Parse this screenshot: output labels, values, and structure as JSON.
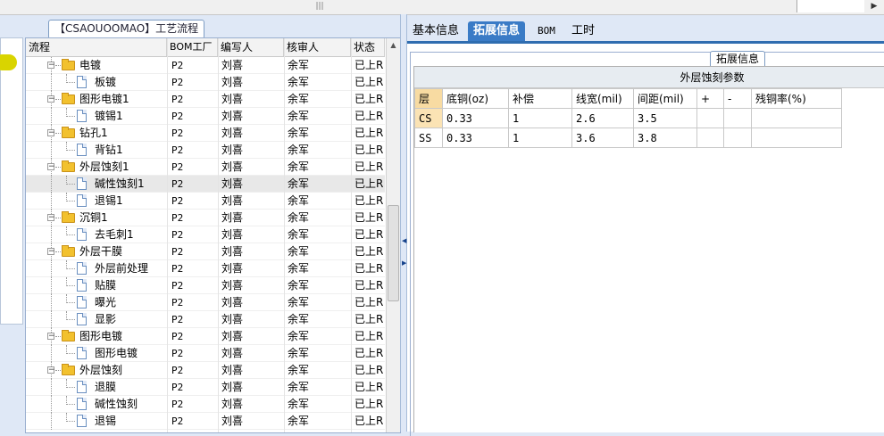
{
  "left_tab_title": "【CSAOUOOMAO】工艺流程",
  "left_grid": {
    "columns": [
      "流程",
      "BOM工厂",
      "编写人",
      "核审人",
      "状态"
    ],
    "rows": [
      {
        "name": "电镀",
        "level": 1,
        "type": "folder",
        "bom": "P2",
        "writer": "刘喜",
        "reviewer": "余军",
        "status": "已上R"
      },
      {
        "name": "板镀",
        "level": 2,
        "type": "doc",
        "bom": "P2",
        "writer": "刘喜",
        "reviewer": "余军",
        "status": "已上R"
      },
      {
        "name": "图形电镀1",
        "level": 1,
        "type": "folder",
        "bom": "P2",
        "writer": "刘喜",
        "reviewer": "余军",
        "status": "已上R"
      },
      {
        "name": "镀锡1",
        "level": 2,
        "type": "doc",
        "bom": "P2",
        "writer": "刘喜",
        "reviewer": "余军",
        "status": "已上R"
      },
      {
        "name": "钻孔1",
        "level": 1,
        "type": "folder",
        "bom": "P2",
        "writer": "刘喜",
        "reviewer": "余军",
        "status": "已上R"
      },
      {
        "name": "背钻1",
        "level": 2,
        "type": "doc",
        "bom": "P2",
        "writer": "刘喜",
        "reviewer": "余军",
        "status": "已上R"
      },
      {
        "name": "外层蚀刻1",
        "level": 1,
        "type": "folder",
        "bom": "P2",
        "writer": "刘喜",
        "reviewer": "余军",
        "status": "已上R"
      },
      {
        "name": "碱性蚀刻1",
        "level": 2,
        "type": "doc",
        "bom": "P2",
        "writer": "刘喜",
        "reviewer": "余军",
        "status": "已上R",
        "selected": true
      },
      {
        "name": "退锡1",
        "level": 2,
        "type": "doc",
        "bom": "P2",
        "writer": "刘喜",
        "reviewer": "余军",
        "status": "已上R"
      },
      {
        "name": "沉铜1",
        "level": 1,
        "type": "folder",
        "bom": "P2",
        "writer": "刘喜",
        "reviewer": "余军",
        "status": "已上R"
      },
      {
        "name": "去毛刺1",
        "level": 2,
        "type": "doc",
        "bom": "P2",
        "writer": "刘喜",
        "reviewer": "余军",
        "status": "已上R"
      },
      {
        "name": "外层干膜",
        "level": 1,
        "type": "folder",
        "bom": "P2",
        "writer": "刘喜",
        "reviewer": "余军",
        "status": "已上R"
      },
      {
        "name": "外层前处理",
        "level": 2,
        "type": "doc",
        "bom": "P2",
        "writer": "刘喜",
        "reviewer": "余军",
        "status": "已上R"
      },
      {
        "name": "贴膜",
        "level": 2,
        "type": "doc",
        "bom": "P2",
        "writer": "刘喜",
        "reviewer": "余军",
        "status": "已上R"
      },
      {
        "name": "曝光",
        "level": 2,
        "type": "doc",
        "bom": "P2",
        "writer": "刘喜",
        "reviewer": "余军",
        "status": "已上R"
      },
      {
        "name": "显影",
        "level": 2,
        "type": "doc",
        "bom": "P2",
        "writer": "刘喜",
        "reviewer": "余军",
        "status": "已上R"
      },
      {
        "name": "图形电镀",
        "level": 1,
        "type": "folder",
        "bom": "P2",
        "writer": "刘喜",
        "reviewer": "余军",
        "status": "已上R"
      },
      {
        "name": "图形电镀",
        "level": 2,
        "type": "doc",
        "bom": "P2",
        "writer": "刘喜",
        "reviewer": "余军",
        "status": "已上R"
      },
      {
        "name": "外层蚀刻",
        "level": 1,
        "type": "folder",
        "bom": "P2",
        "writer": "刘喜",
        "reviewer": "余军",
        "status": "已上R"
      },
      {
        "name": "退膜",
        "level": 2,
        "type": "doc",
        "bom": "P2",
        "writer": "刘喜",
        "reviewer": "余军",
        "status": "已上R"
      },
      {
        "name": "碱性蚀刻",
        "level": 2,
        "type": "doc",
        "bom": "P2",
        "writer": "刘喜",
        "reviewer": "余军",
        "status": "已上R"
      },
      {
        "name": "退锡",
        "level": 2,
        "type": "doc",
        "bom": "P2",
        "writer": "刘喜",
        "reviewer": "余军",
        "status": "已上R"
      }
    ]
  },
  "tabs": [
    {
      "label": "基本信息",
      "active": false,
      "small": false
    },
    {
      "label": "拓展信息",
      "active": true,
      "small": false
    },
    {
      "label": "BOM",
      "active": false,
      "small": true
    },
    {
      "label": "工时",
      "active": false,
      "small": false
    }
  ],
  "ext_legend": "拓展信息",
  "param_table": {
    "title": "外层蚀刻参数",
    "headers": [
      "层",
      "底铜(oz)",
      "补偿",
      "线宽(mil)",
      "间距(mil)",
      "+",
      "-",
      "残铜率(%)"
    ],
    "rows": [
      [
        "CS",
        "0.33",
        "1",
        "2.6",
        "3.5",
        "",
        "",
        ""
      ],
      [
        "SS",
        "0.33",
        "1",
        "3.6",
        "3.8",
        "",
        "",
        ""
      ]
    ]
  },
  "colors": {
    "active_tab": "#3a7bc6",
    "folder": "#f2c12e",
    "layer_highlight": "#fbe3b4"
  }
}
